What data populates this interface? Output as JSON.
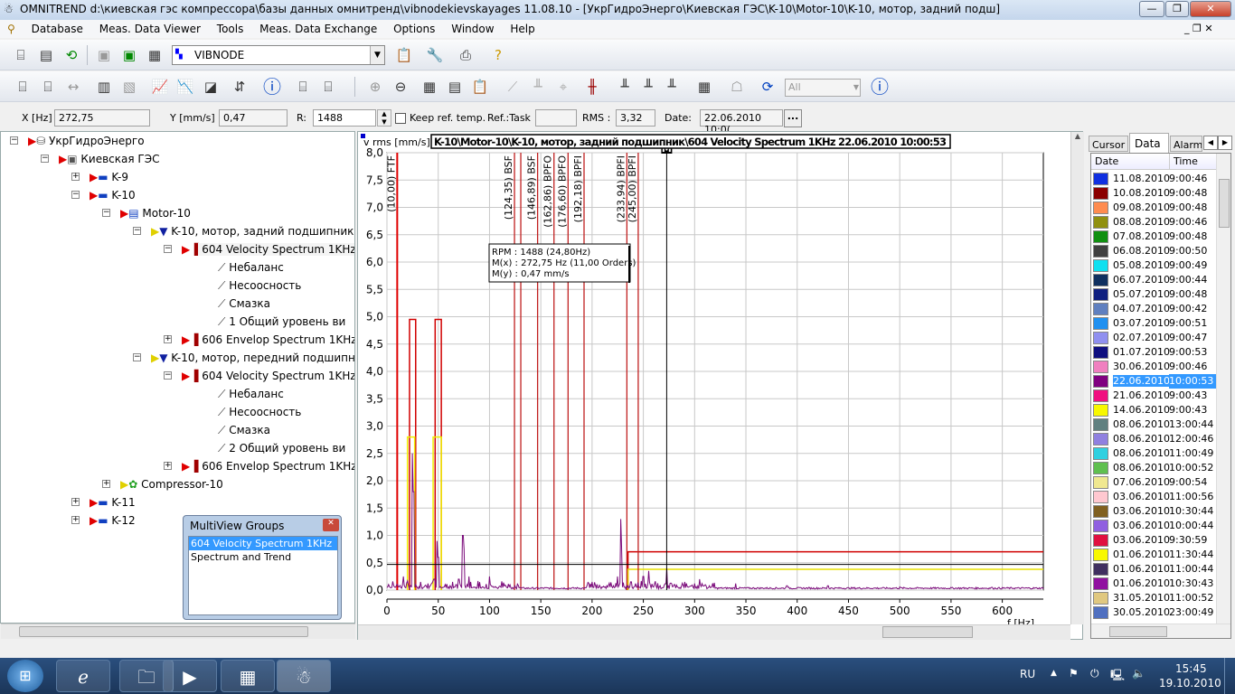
{
  "window": {
    "title": "OMNITREND d:\\киевская гэс компрессора\\базы данных омнитренд\\vibnodekievskayages 11.08.10 - [УкрГидроЭнерго\\Киевская ГЭС\\K-10\\Motor-10\\K-10, мотор, задний подш]",
    "minimize": "—",
    "maximize": "❐",
    "close": "✕"
  },
  "menu": [
    "Database",
    "Meas. Data Viewer",
    "Tools",
    "Meas. Data Exchange",
    "Options",
    "Window",
    "Help"
  ],
  "toolbar": {
    "database_select": "VIBNODE",
    "filter_select": "All"
  },
  "cursor": {
    "x_label": "X [Hz]",
    "x_value": "272,75",
    "y_label": "Y [mm/s]",
    "y_value": "0,47",
    "r_label": "R:",
    "r_value": "1488",
    "keep_ref": "Keep ref. temp.",
    "ref_task_label": "Ref.:Task",
    "ref_task_value": "",
    "rms_label": "RMS :",
    "rms_value": "3,32",
    "date_label": "Date:",
    "date_value": "22.06.2010 10:0(",
    "more": "..."
  },
  "tree": [
    {
      "level": 0,
      "label": "УкрГидроЭнерго",
      "exp": "-",
      "icon": "database"
    },
    {
      "level": 1,
      "label": "Киевская ГЭС",
      "exp": "-",
      "icon": "plant"
    },
    {
      "level": 2,
      "label": "K-9",
      "exp": "+",
      "icon": "machine"
    },
    {
      "level": 2,
      "label": "K-10",
      "exp": "-",
      "icon": "machine"
    },
    {
      "level": 3,
      "label": "Motor-10",
      "exp": "-",
      "icon": "motor"
    },
    {
      "level": 4,
      "label": "K-10, мотор, задний подшипник",
      "exp": "-",
      "icon": "point"
    },
    {
      "level": 5,
      "label": "604 Velocity Spectrum 1KHz",
      "exp": "-",
      "icon": "spectrum",
      "selected": true
    },
    {
      "level": 6,
      "label": "Небаланс",
      "icon": "trend"
    },
    {
      "level": 6,
      "label": "Несоосность",
      "icon": "trend"
    },
    {
      "level": 6,
      "label": "Смазка",
      "icon": "trend"
    },
    {
      "level": 6,
      "label": "1 Общий уровень ви",
      "icon": "trend"
    },
    {
      "level": 5,
      "label": "606 Envelop Spectrum 1KHz",
      "exp": "+",
      "icon": "spectrum"
    },
    {
      "level": 4,
      "label": "K-10, мотор, передний подшипни",
      "exp": "-",
      "icon": "point"
    },
    {
      "level": 5,
      "label": "604 Velocity Spectrum 1KHz",
      "exp": "-",
      "icon": "spectrum"
    },
    {
      "level": 6,
      "label": "Небаланс",
      "icon": "trend"
    },
    {
      "level": 6,
      "label": "Несоосность",
      "icon": "trend"
    },
    {
      "level": 6,
      "label": "Смазка",
      "icon": "trend"
    },
    {
      "level": 6,
      "label": "2 Общий уровень ви",
      "icon": "trend"
    },
    {
      "level": 5,
      "label": "606 Envelop Spectrum 1KHz",
      "exp": "+",
      "icon": "spectrum"
    },
    {
      "level": 3,
      "label": "Compressor-10",
      "exp": "+",
      "icon": "compressor"
    },
    {
      "level": 2,
      "label": "K-11",
      "exp": "+",
      "icon": "machine"
    },
    {
      "level": 2,
      "label": "K-12",
      "exp": "+",
      "icon": "machine"
    }
  ],
  "multiview": {
    "title": "MultiView Groups",
    "items": [
      "604 Velocity Spectrum 1KHz",
      "Spectrum and Trend"
    ],
    "selected": 0
  },
  "chart_data": {
    "type": "line",
    "title": "K-10\\Motor-10\\K-10, мотор, задний подшипник\\604 Velocity Spectrum 1KHz 22.06.2010 10:00:53",
    "ylabel": "v rms [mm/s]",
    "xlabel": "f [Hz]",
    "xlim": [
      0,
      640
    ],
    "ylim": [
      0,
      8
    ],
    "xticks": [
      0,
      50,
      100,
      150,
      200,
      250,
      300,
      350,
      400,
      450,
      500,
      550,
      600
    ],
    "yticks": [
      "0,0",
      "0,5",
      "1,0",
      "1,5",
      "2,0",
      "2,5",
      "3,0",
      "3,5",
      "4,0",
      "4,5",
      "5,0",
      "5,5",
      "6,0",
      "6,5",
      "7,0",
      "7,5",
      "8,0"
    ],
    "grid": true,
    "series_color": "#7a0a7a",
    "peaks": [
      [
        10,
        0.1
      ],
      [
        16,
        0.25
      ],
      [
        25,
        2.5
      ],
      [
        26,
        1.8
      ],
      [
        33,
        0.15
      ],
      [
        40,
        0.12
      ],
      [
        46,
        0.2
      ],
      [
        49,
        0.9
      ],
      [
        50,
        0.6
      ],
      [
        57,
        0.1
      ],
      [
        64,
        0.15
      ],
      [
        70,
        0.2
      ],
      [
        74,
        1.0
      ],
      [
        75,
        0.75
      ],
      [
        80,
        0.25
      ],
      [
        100,
        0.25
      ],
      [
        200,
        0.15
      ],
      [
        225,
        0.25
      ],
      [
        228,
        1.3
      ],
      [
        229,
        0.8
      ],
      [
        238,
        0.15
      ],
      [
        250,
        0.25
      ],
      [
        255,
        0.35
      ],
      [
        272.75,
        0.4
      ],
      [
        280,
        0.1
      ],
      [
        300,
        0.12
      ],
      [
        305,
        0.2
      ],
      [
        340,
        0.12
      ],
      [
        390,
        0.08
      ],
      [
        430,
        0.08
      ],
      [
        500,
        0.06
      ],
      [
        590,
        0.05
      ]
    ],
    "markers": [
      {
        "f": 10.0,
        "label": "(10,00) FTF"
      },
      {
        "f": 124.35,
        "label": "(124,35) BSF"
      },
      {
        "f": 130.5,
        "label": ""
      },
      {
        "f": 146.89,
        "label": "(146,89) BSF"
      },
      {
        "f": 162.86,
        "label": "(162,86) BPFO"
      },
      {
        "f": 176.6,
        "label": "(176,60) BPFO"
      },
      {
        "f": 192.18,
        "label": "(192,18) BPFI"
      },
      {
        "f": 233.94,
        "label": "(233,94) BPFI"
      },
      {
        "f": 245.0,
        "label": "(245,00) BPFI"
      }
    ],
    "alarm_bands": [
      {
        "f": [
          22,
          28
        ],
        "level": 4.95,
        "color": "#d00000"
      },
      {
        "f": [
          47,
          53
        ],
        "level": 4.95,
        "color": "#d00000"
      },
      {
        "f": [
          20,
          27
        ],
        "level": 2.8,
        "color": "#f0f000"
      },
      {
        "f": [
          45,
          53
        ],
        "level": 2.8,
        "color": "#f0f000"
      },
      {
        "f": [
          235,
          640
        ],
        "level": 0.7,
        "color": "#d00000"
      },
      {
        "f": [
          235,
          640
        ],
        "level": 0.38,
        "color": "#e8e000"
      }
    ],
    "cursor": {
      "f": 272.75,
      "y": 0.47,
      "label": "M"
    },
    "tooltip": [
      "RPM : 1488 (24,80Hz)",
      "M(x) : 272,75 Hz (11,00 Orders)",
      "M(y) : 0,47 mm/s"
    ]
  },
  "right": {
    "tabs": [
      "Cursor",
      "Data",
      "Alarms"
    ],
    "active": 1,
    "columns": [
      "Date",
      "Time"
    ],
    "rows": [
      [
        "11.08.2010",
        "9:00:46",
        "#1030e0"
      ],
      [
        "10.08.2010",
        "9:00:48",
        "#8b0000"
      ],
      [
        "09.08.2010",
        "9:00:48",
        "#ff8c50"
      ],
      [
        "08.08.2010",
        "9:00:46",
        "#909010"
      ],
      [
        "07.08.2010",
        "9:00:48",
        "#109010"
      ],
      [
        "06.08.2010",
        "9:00:50",
        "#404040"
      ],
      [
        "05.08.2010",
        "9:00:49",
        "#10e0f0"
      ],
      [
        "06.07.2010",
        "9:00:44",
        "#103060"
      ],
      [
        "05.07.2010",
        "9:00:48",
        "#102080"
      ],
      [
        "04.07.2010",
        "9:00:42",
        "#6080c0"
      ],
      [
        "03.07.2010",
        "9:00:51",
        "#2090f0"
      ],
      [
        "02.07.2010",
        "9:00:47",
        "#9090f0"
      ],
      [
        "01.07.2010",
        "9:00:53",
        "#101080"
      ],
      [
        "30.06.2010",
        "9:00:46",
        "#f080c0"
      ],
      [
        "22.06.2010",
        "10:00:53",
        "#800080"
      ],
      [
        "21.06.2010",
        "9:00:43",
        "#f01080"
      ],
      [
        "14.06.2010",
        "9:00:43",
        "#f8f800"
      ],
      [
        "08.06.2010",
        "13:00:44",
        "#608080"
      ],
      [
        "08.06.2010",
        "12:00:46",
        "#9080e0"
      ],
      [
        "08.06.2010",
        "11:00:49",
        "#30d0e0"
      ],
      [
        "08.06.2010",
        "10:00:52",
        "#60c050"
      ],
      [
        "07.06.2010",
        "9:00:54",
        "#f0e890"
      ],
      [
        "03.06.2010",
        "11:00:56",
        "#ffc8d0"
      ],
      [
        "03.06.2010",
        "10:30:44",
        "#806020"
      ],
      [
        "03.06.2010",
        "10:00:44",
        "#9060e0"
      ],
      [
        "03.06.2010",
        "9:30:59",
        "#e01040"
      ],
      [
        "01.06.2010",
        "11:30:44",
        "#f8f800"
      ],
      [
        "01.06.2010",
        "11:00:44",
        "#403060"
      ],
      [
        "01.06.2010",
        "10:30:43",
        "#9010a0"
      ],
      [
        "31.05.2010",
        "11:00:52",
        "#e0c880"
      ],
      [
        "30.05.2010",
        "23:00:49",
        "#5070c0"
      ]
    ],
    "selected": 14
  },
  "taskbar": {
    "lang": "RU",
    "time": "15:45",
    "date": "19.10.2010"
  }
}
